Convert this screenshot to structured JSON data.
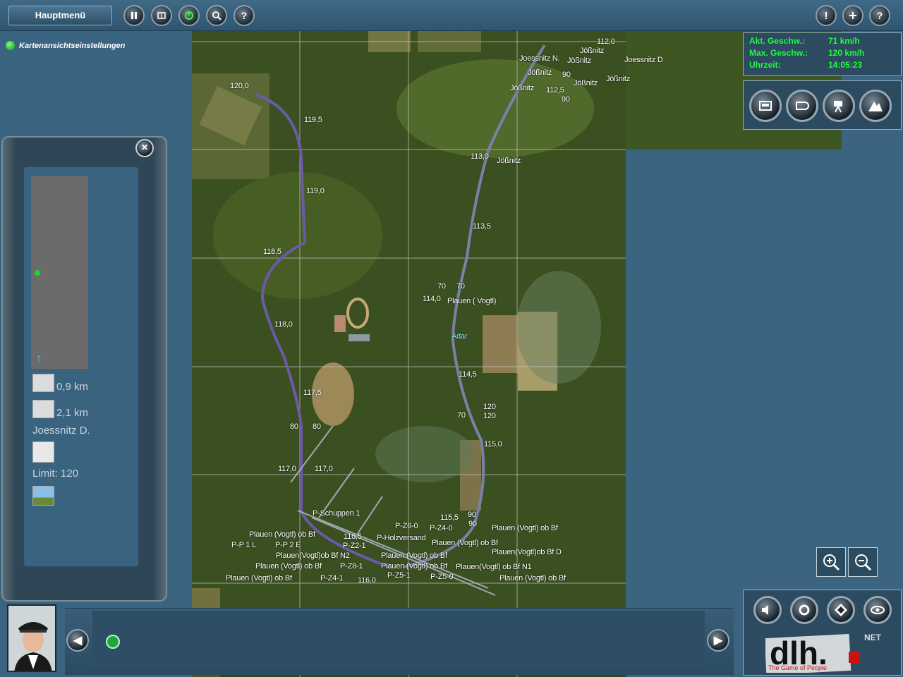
{
  "topbar": {
    "main_menu_label": "Hauptmenü",
    "help_label": "?"
  },
  "map_settings_label": "Kartenansichtseinstellungen",
  "info": {
    "speed_label": "Akt. Geschw.:",
    "speed_value": "71 km/h",
    "max_speed_label": "Max. Geschw.:",
    "max_speed_value": "120 km/h",
    "time_label": "Uhrzeit:",
    "time_value": "14:05:23"
  },
  "left_panel": {
    "dist1": "0,9 km",
    "dist2": "2,1 km",
    "station": "Joessnitz D.",
    "limit": "Limit: 120"
  },
  "map_labels": [
    {
      "text": "112,0"
    },
    {
      "text": "Joessnitz N."
    },
    {
      "text": "Jößnitz"
    },
    {
      "text": "Jößnitz"
    },
    {
      "text": "Joessnitz D"
    },
    {
      "text": "Jößnitz"
    },
    {
      "text": "90"
    },
    {
      "text": "Jößnitz"
    },
    {
      "text": "Jößnitz"
    },
    {
      "text": "Jößnitz"
    },
    {
      "text": "112,5"
    },
    {
      "text": "90"
    },
    {
      "text": "120,0"
    },
    {
      "text": "119,5"
    },
    {
      "text": "113,0"
    },
    {
      "text": "Jößnitz"
    },
    {
      "text": "119,0"
    },
    {
      "text": "113,5"
    },
    {
      "text": "118,5"
    },
    {
      "text": "70"
    },
    {
      "text": "70"
    },
    {
      "text": "114,0"
    },
    {
      "text": "Plauen ( Vogtl)"
    },
    {
      "text": "118,0"
    },
    {
      "text": "Adar"
    },
    {
      "text": "114,5"
    },
    {
      "text": "117,5"
    },
    {
      "text": "120"
    },
    {
      "text": "70"
    },
    {
      "text": "120"
    },
    {
      "text": "80"
    },
    {
      "text": "80"
    },
    {
      "text": "115,0"
    },
    {
      "text": "117,0"
    },
    {
      "text": "117,0"
    },
    {
      "text": "P-Schuppen 1"
    },
    {
      "text": "115,5"
    },
    {
      "text": "90"
    },
    {
      "text": "90"
    },
    {
      "text": "P-Z6-0"
    },
    {
      "text": "P-Z4-0"
    },
    {
      "text": "Plauen (Vogtl) ob Bf"
    },
    {
      "text": "Plauen (Vogtl) ob Bf"
    },
    {
      "text": "116,5"
    },
    {
      "text": "P-Holzversand"
    },
    {
      "text": "P-P 1 L"
    },
    {
      "text": "P-P 2 E"
    },
    {
      "text": "P-Z2-1"
    },
    {
      "text": "Plauen (Vogtl) ob Bf"
    },
    {
      "text": "Plauen(Vogtl)ob Bf N2"
    },
    {
      "text": "Plauen (Vogtl) ob Bf"
    },
    {
      "text": "Plauen(Vogtl)ob Bf D"
    },
    {
      "text": "Plauen (Vogtl) ob Bf"
    },
    {
      "text": "P-Z8-1"
    },
    {
      "text": "Plauen (Vogtl) ob Bf"
    },
    {
      "text": "Plauen(Vogtl) ob Bf N1"
    },
    {
      "text": "Plauen (Vogtl) ob Bf"
    },
    {
      "text": "P-Z4-1"
    },
    {
      "text": "116,0"
    },
    {
      "text": "P-Z5-1"
    },
    {
      "text": "P-Z5-0"
    },
    {
      "text": "Plauen (Vogtl) ob Bf"
    }
  ],
  "colors": {
    "background": "#3b6480",
    "info_text": "#1cff3a",
    "map_grass": "#3b5020",
    "track": "#6a5aa8"
  },
  "logo": {
    "brand": "dlh.",
    "net": "NET",
    "tagline": "The Game of People"
  }
}
